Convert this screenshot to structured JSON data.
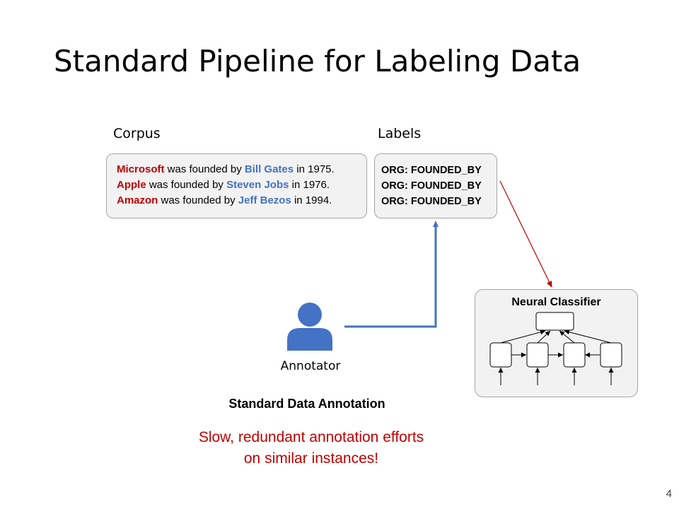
{
  "slide": {
    "title": "Standard Pipeline for Labeling Data",
    "page_number": "4"
  },
  "corpus": {
    "label": "Corpus",
    "sentences": [
      {
        "org": "Microsoft",
        "mid": " was founded by ",
        "person": "Bill Gates",
        "tail": " in 1975."
      },
      {
        "org": "Apple",
        "mid": " was founded by ",
        "person": "Steven Jobs",
        "tail": " in 1976."
      },
      {
        "org": "Amazon",
        "mid": " was founded by ",
        "person": "Jeff Bezos",
        "tail": " in 1994."
      }
    ]
  },
  "labels": {
    "label": "Labels",
    "items": [
      "ORG: FOUNDED_BY",
      "ORG: FOUNDED_BY",
      "ORG: FOUNDED_BY"
    ]
  },
  "annotator": {
    "label": "Annotator",
    "icon": "person-icon"
  },
  "classifier": {
    "title": "Neural Classifier"
  },
  "caption": "Standard Data Annotation",
  "warning": [
    "Slow, redundant annotation efforts",
    "on similar instances!"
  ],
  "colors": {
    "org": "#c00000",
    "person": "#4472c4",
    "annotator_arrow": "#4472c4",
    "classifier_arrow": "#c00000",
    "box_fill": "#f2f2f2",
    "box_border": "#a6a6a6",
    "warning": "#c00000"
  }
}
